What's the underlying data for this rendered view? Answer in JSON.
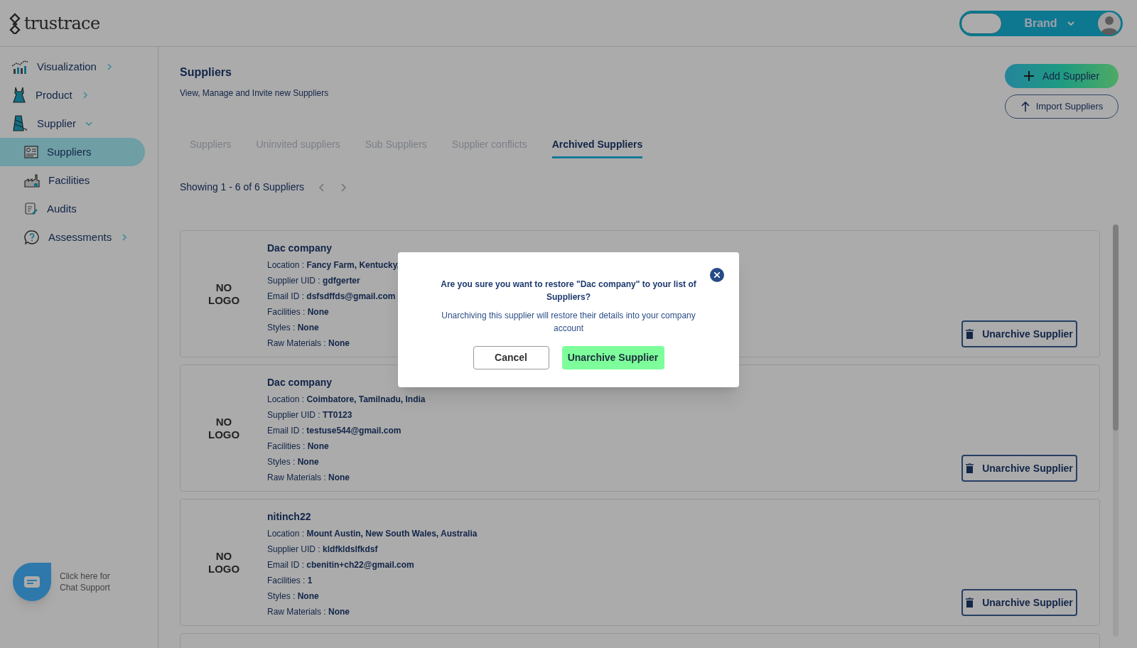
{
  "header": {
    "logo": "trustrace",
    "role_switch": {
      "label": "Brand",
      "on": false
    }
  },
  "sidebar": {
    "items": [
      {
        "label": "Visualization",
        "kind": "group",
        "expanded": false,
        "selected": false
      },
      {
        "label": "Product",
        "kind": "group",
        "expanded": false,
        "selected": false
      },
      {
        "label": "Supplier",
        "kind": "group",
        "expanded": true,
        "selected": false,
        "children": [
          {
            "label": "Suppliers",
            "kind": "link",
            "selected": true
          },
          {
            "label": "Facilities",
            "kind": "link",
            "selected": false
          },
          {
            "label": "Audits",
            "kind": "link",
            "selected": false
          },
          {
            "label": "Assessments",
            "kind": "group",
            "expanded": false,
            "selected": false
          }
        ]
      }
    ]
  },
  "chat_support": {
    "label": "Click here for Chat Support"
  },
  "page": {
    "title": "Suppliers",
    "subtitle": "View, Manage and Invite new Suppliers",
    "add_button": "Add Supplier",
    "import_button": "Import Suppliers"
  },
  "tabs": [
    {
      "label": "Suppliers",
      "selected": false
    },
    {
      "label": "Uninvited suppliers",
      "selected": false
    },
    {
      "label": "Sub Suppliers",
      "selected": false
    },
    {
      "label": "Supplier conflicts",
      "selected": false
    },
    {
      "label": "Archived Suppliers",
      "selected": true
    }
  ],
  "pagination": {
    "summary": "Showing 1 - 6 of 6 Suppliers"
  },
  "suppliers": [
    {
      "logo_placeholder": "NO LOGO",
      "name": "Dac company",
      "fields": [
        {
          "label": "Location :",
          "value": "Fancy Farm, Kentucky,"
        },
        {
          "label": "Supplier UID :",
          "value": "gdfgerter"
        },
        {
          "label": "Email ID :",
          "value": "dsfsdffds@gmail.com"
        },
        {
          "label": "Facilities :",
          "value": "None"
        },
        {
          "label": "Styles :",
          "value": "None"
        },
        {
          "label": "Raw Materials :",
          "value": "None"
        }
      ],
      "action": "Unarchive Supplier"
    },
    {
      "logo_placeholder": "NO LOGO",
      "name": "Dac company",
      "fields": [
        {
          "label": "Location :",
          "value": "Coimbatore, Tamilnadu, India"
        },
        {
          "label": "Supplier UID :",
          "value": "TT0123"
        },
        {
          "label": "Email ID :",
          "value": "testuse544@gmail.com"
        },
        {
          "label": "Facilities :",
          "value": "None"
        },
        {
          "label": "Styles :",
          "value": "None"
        },
        {
          "label": "Raw Materials :",
          "value": "None"
        }
      ],
      "action": "Unarchive Supplier"
    },
    {
      "logo_placeholder": "NO LOGO",
      "name": "nitinch22",
      "fields": [
        {
          "label": "Location :",
          "value": "Mount Austin, New South Wales, Australia"
        },
        {
          "label": "Supplier UID :",
          "value": "kldfkldslfkdsf"
        },
        {
          "label": "Email ID :",
          "value": "cbenitin+ch22@gmail.com"
        },
        {
          "label": "Facilities :",
          "value": "1"
        },
        {
          "label": "Styles :",
          "value": "None"
        },
        {
          "label": "Raw Materials :",
          "value": "None"
        }
      ],
      "action": "Unarchive Supplier"
    }
  ],
  "dialog": {
    "question": "Are you sure you want to restore \"Dac company\" to your list of Suppliers?",
    "message": "Unarchiving this supplier will restore their details into your company account",
    "cancel": "Cancel",
    "confirm": "Unarchive Supplier"
  }
}
